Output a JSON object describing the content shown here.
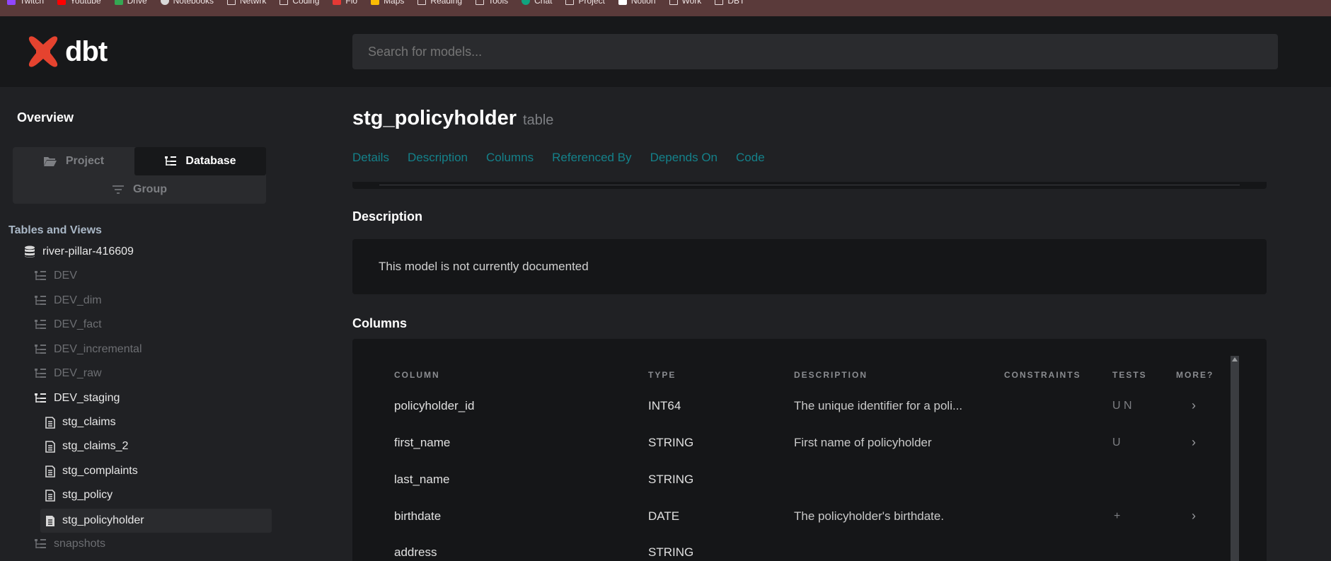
{
  "bookmarks": [
    {
      "label": "Twitch",
      "icon": "twitch-icon",
      "color": "#9146ff"
    },
    {
      "label": "Youtube",
      "icon": "youtube-icon",
      "color": "#ff0000"
    },
    {
      "label": "Drive",
      "icon": "drive-icon",
      "color": "#34a853"
    },
    {
      "label": "Notebooks",
      "icon": "globe-icon",
      "color": "#d8d8d8"
    },
    {
      "label": "Netwrk",
      "icon": "folder-icon",
      "color": ""
    },
    {
      "label": "Coding",
      "icon": "folder-icon",
      "color": ""
    },
    {
      "label": "Flo",
      "icon": "flo-icon",
      "color": "#e53935"
    },
    {
      "label": "Maps",
      "icon": "maps-icon",
      "color": "#fbbc04"
    },
    {
      "label": "Reading",
      "icon": "folder-icon",
      "color": ""
    },
    {
      "label": "Tools",
      "icon": "folder-icon",
      "color": ""
    },
    {
      "label": "Chat",
      "icon": "chat-icon",
      "color": "#10a37f"
    },
    {
      "label": "Project",
      "icon": "folder-icon",
      "color": ""
    },
    {
      "label": "Notion",
      "icon": "notion-icon",
      "color": "#ffffff"
    },
    {
      "label": "Work",
      "icon": "folder-icon",
      "color": ""
    },
    {
      "label": "DBT",
      "icon": "folder-icon",
      "color": ""
    }
  ],
  "header": {
    "logo_text": "dbt",
    "logo_color": "#e5432f",
    "search_placeholder": "Search for models..."
  },
  "sidebar": {
    "overview": "Overview",
    "toggle": {
      "project": "Project",
      "database": "Database",
      "group": "Group"
    },
    "tables_title": "Tables and Views",
    "database_name": "river-pillar-416609",
    "schemas": [
      "DEV",
      "DEV_dim",
      "DEV_fact",
      "DEV_incremental",
      "DEV_raw"
    ],
    "open_schema": "DEV_staging",
    "models": [
      "stg_claims",
      "stg_claims_2",
      "stg_complaints",
      "stg_policy",
      "stg_policyholder"
    ],
    "after_schema": "snapshots"
  },
  "main": {
    "model_name": "stg_policyholder",
    "model_type": "table",
    "tabs": [
      "Details",
      "Description",
      "Columns",
      "Referenced By",
      "Depends On",
      "Code"
    ],
    "description_title": "Description",
    "description_text": "This model is not currently documented",
    "columns_title": "Columns",
    "column_headers": {
      "column": "COLUMN",
      "type": "TYPE",
      "description": "DESCRIPTION",
      "constraints": "CONSTRAINTS",
      "tests": "TESTS",
      "more": "MORE?"
    },
    "rows": [
      {
        "name": "policyholder_id",
        "type": "INT64",
        "description": "The unique identifier for a poli...",
        "tests": "U N",
        "more": "›"
      },
      {
        "name": "first_name",
        "type": "STRING",
        "description": "First name of policyholder",
        "tests": "U",
        "more": "›"
      },
      {
        "name": "last_name",
        "type": "STRING",
        "description": "",
        "tests": "",
        "more": ""
      },
      {
        "name": "birthdate",
        "type": "DATE",
        "description": "The policyholder's birthdate.",
        "tests": "+",
        "more": "›"
      },
      {
        "name": "address",
        "type": "STRING",
        "description": "",
        "tests": "",
        "more": ""
      }
    ]
  }
}
